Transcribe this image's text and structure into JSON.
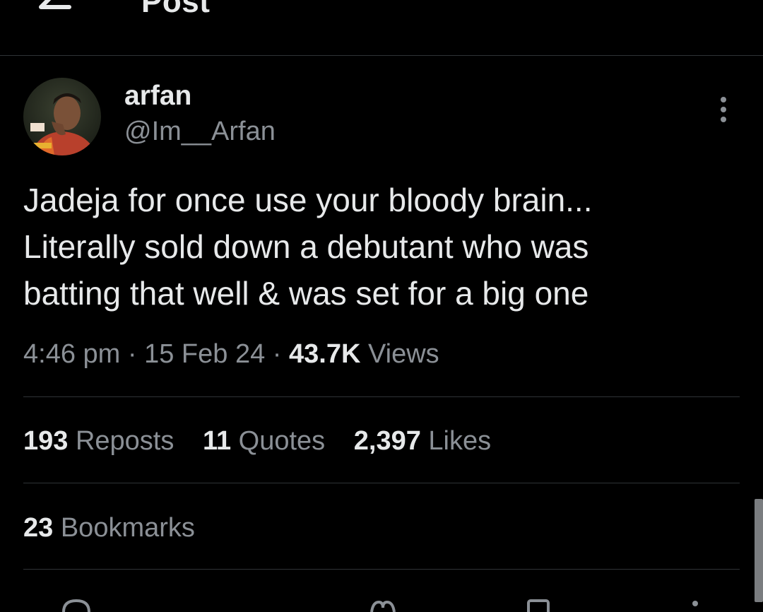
{
  "header": {
    "title": "Post",
    "back_icon": "arrow-left-icon"
  },
  "author": {
    "display_name": "arfan",
    "handle": "@Im__Arfan",
    "avatar_icon": "profile-photo-avatar"
  },
  "tweet": {
    "lines": [
      "Jadeja for once use your bloody brain...",
      "Literally sold down a debutant who was",
      "batting that well & was set for a big one"
    ]
  },
  "meta": {
    "time": "4:46 pm",
    "sep1": " · ",
    "date": "15 Feb 24",
    "sep2": " · ",
    "views_count": "43.7K",
    "views_label": " Views"
  },
  "stats": {
    "reposts": {
      "count": "193",
      "label": " Reposts"
    },
    "quotes": {
      "count": "11",
      "label": " Quotes"
    },
    "likes": {
      "count": "2,397",
      "label": " Likes"
    },
    "bookmarks": {
      "count": "23",
      "label": " Bookmarks"
    }
  },
  "colors": {
    "background": "#000000",
    "text": "#e7e9ea",
    "secondary": "#8b9096",
    "divider": "#2f3336"
  }
}
